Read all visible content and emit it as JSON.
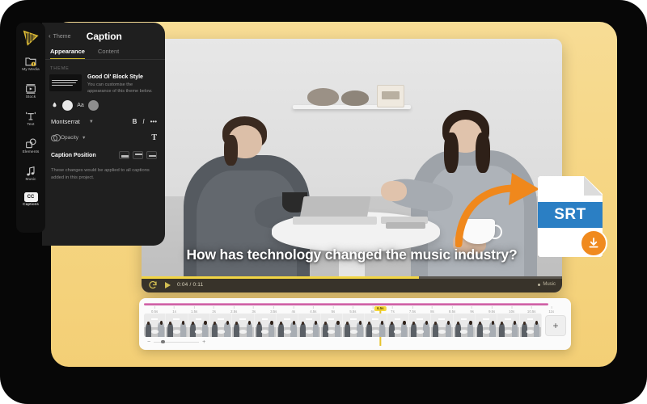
{
  "app": {
    "logo_icon": "video-editor-logo-icon"
  },
  "rail": {
    "items": [
      {
        "label": "My Media",
        "icon": "folder-alert-icon",
        "active": false
      },
      {
        "label": "Stock",
        "icon": "stock-video-icon",
        "active": false
      },
      {
        "label": "Text",
        "icon": "text-tool-icon",
        "active": false
      },
      {
        "label": "Elements",
        "icon": "elements-shapes-icon",
        "active": false
      },
      {
        "label": "Music",
        "icon": "music-note-icon",
        "active": false
      },
      {
        "label": "Captions",
        "icon": "closed-captions-icon",
        "active": true,
        "badge": "CC"
      }
    ]
  },
  "panel": {
    "back_label": "Theme",
    "title": "Caption",
    "tabs": [
      {
        "label": "Appearance",
        "active": true
      },
      {
        "label": "Content",
        "active": false
      }
    ],
    "section_label": "THEME",
    "theme": {
      "name": "Good Ol' Block Style",
      "description": "You can customise the appearance of this theme below."
    },
    "swatches": {
      "fill_icon": "fill-drop-icon",
      "fill_color": "#e9e9e9",
      "text_icon_label": "Aa",
      "text_color": "#8d8d8d"
    },
    "font": {
      "name": "Montserrat",
      "bold_label": "B",
      "italic_label": "I",
      "more_label": "•••"
    },
    "opacity": {
      "label": "Opacity",
      "text_size_label": "T"
    },
    "caption_position": {
      "label": "Caption Position",
      "options": [
        "bottom",
        "top",
        "middle"
      ]
    },
    "note": "These changes would be applied to all captions added in this project."
  },
  "player": {
    "caption": "How has technology changed the music industry?",
    "current_time": "0:04",
    "total_time": "0:11",
    "time_display": "0:04 / 0:11",
    "loop_icon": "loop-icon",
    "play_icon": "play-icon",
    "track_label": "Music",
    "progress_percent": 66
  },
  "timeline": {
    "ticks": [
      "0.5s",
      "1s",
      "1.5s",
      "2s",
      "2.5s",
      "3s",
      "3.5s",
      "4s",
      "4.5s",
      "5s",
      "5.5s",
      "6s",
      "7s",
      "7.5s",
      "8s",
      "8.5s",
      "9s",
      "9.5s",
      "10s",
      "10.5s",
      "11s"
    ],
    "playhead_label": "6.5s",
    "playhead_percent": 56,
    "thumbnail_count": 18,
    "add_track_label": "+",
    "zoom": {
      "minus_label": "−",
      "plus_label": "+",
      "value_percent": 16
    }
  },
  "srt_graphic": {
    "file_type_label": "SRT",
    "download_icon": "download-icon",
    "arrow_icon": "curved-export-arrow-icon",
    "band_color": "#2b7fc4",
    "badge_color": "#f08a1e"
  },
  "colors": {
    "frame": "#070707",
    "card": "#f6d98a",
    "panel": "#1f1f1f",
    "accent": "#cdb62c",
    "ruler": "#d463a8",
    "playhead": "#f5d83a"
  }
}
